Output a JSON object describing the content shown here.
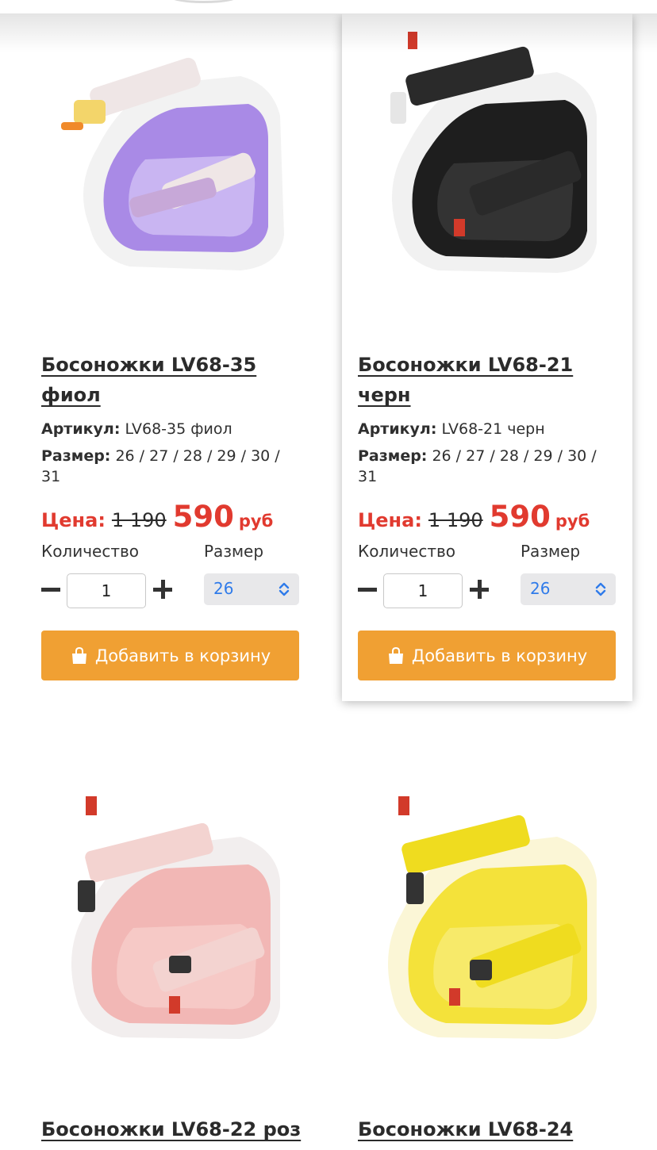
{
  "labels": {
    "article": "Артикул:",
    "size": "Размер:",
    "price": "Цена:",
    "quantity": "Количество",
    "size_select": "Размер",
    "add_to_cart": "Добавить в корзину"
  },
  "products": [
    {
      "title": "Босоножки LV68-35 фиол",
      "article": "LV68-35 фиол",
      "sizes": "26 / 27 / 28 / 29 / 30 / 31",
      "old_price": "1 190",
      "new_price": "590",
      "currency": "руб",
      "quantity": "1",
      "selected_size": "26",
      "color": "#a98ae6"
    },
    {
      "title": "Босоножки LV68-21 черн",
      "article": "LV68-21 черн",
      "sizes": "26 / 27 / 28 / 29 / 30 / 31",
      "old_price": "1 190",
      "new_price": "590",
      "currency": "руб",
      "quantity": "1",
      "selected_size": "26",
      "color": "#1e1e1e"
    },
    {
      "title": "Босоножки LV68-22 роз",
      "color": "#f2b7b5"
    },
    {
      "title": "Босоножки LV68-24",
      "color": "#f4e23a"
    }
  ],
  "colors": {
    "accent_red": "#e13a2f",
    "button_orange": "#f0a033",
    "select_blue": "#2f7bea"
  }
}
